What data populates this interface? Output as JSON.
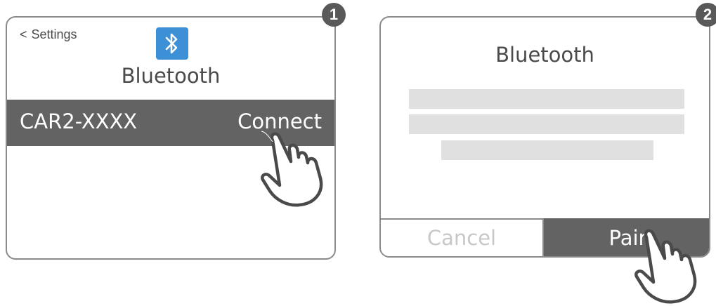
{
  "step1": {
    "badge": "1",
    "back_label": "Settings",
    "title": "Bluetooth",
    "device_name": "CAR2-XXXX",
    "connect_label": "Connect",
    "icon": "bluetooth-icon"
  },
  "step2": {
    "badge": "2",
    "title": "Bluetooth",
    "cancel_label": "Cancel",
    "pair_label": "Pair"
  },
  "colors": {
    "accent": "#3d8fd6",
    "dark_bar": "#636363",
    "placeholder": "#e0e0e0",
    "border": "#8a8a8a"
  }
}
